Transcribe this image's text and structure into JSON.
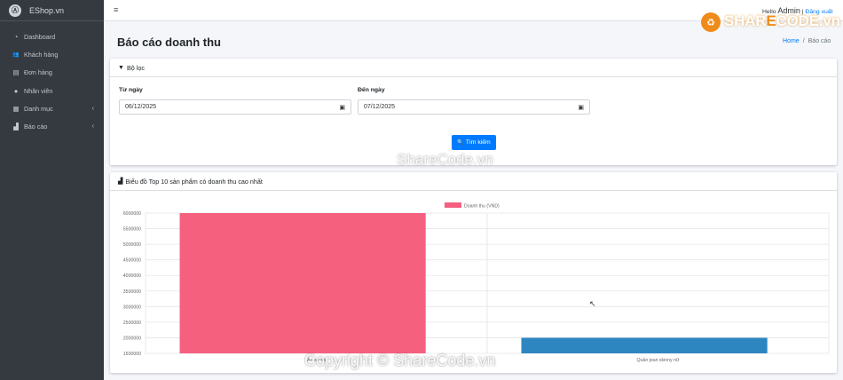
{
  "sidebar": {
    "brand": "EShop.vn",
    "brand_logo": "Ⓐ",
    "items": [
      {
        "label": "Dashboard",
        "icon": "dashboard-icon",
        "glyph": "◔"
      },
      {
        "label": "Khách hàng",
        "icon": "users-icon",
        "glyph": "👥"
      },
      {
        "label": "Đơn hàng",
        "icon": "file-icon",
        "glyph": "▤"
      },
      {
        "label": "Nhân viên",
        "icon": "user-icon",
        "glyph": "●"
      },
      {
        "label": "Danh mục",
        "icon": "table-icon",
        "glyph": "▦",
        "chevron": "‹"
      },
      {
        "label": "Báo cáo",
        "icon": "chart-icon",
        "glyph": "▟",
        "chevron": "‹"
      }
    ]
  },
  "topbar": {
    "menu_glyph": "≡",
    "hello": "Hello",
    "user": "Admin",
    "separator": "|",
    "logout": "Đăng xuất"
  },
  "logo": {
    "glyph": "♻",
    "pre": "SHAR",
    "o": "E",
    "post": "CODE.vn"
  },
  "page": {
    "title": "Báo cáo doanh thu",
    "breadcrumb": {
      "home": "Home",
      "sep": "/",
      "current": "Báo cáo"
    }
  },
  "filter": {
    "title": "Bộ lọc",
    "title_glyph": "▼",
    "from_label": "Từ ngày",
    "from_value": "06/12/2025",
    "to_label": "Đến ngày",
    "to_value": "07/12/2025",
    "cal_glyph": "▣",
    "search_glyph": "🔍",
    "search_label": "Tìm kiếm"
  },
  "chart_card": {
    "title": "Biểu đồ Top 10 sản phẩm có doanh thu cao nhất",
    "title_glyph": "▟"
  },
  "chart_data": {
    "type": "bar",
    "categories": [
      "Áo sơ mi",
      "Quần jean skinny nữ"
    ],
    "series": [
      {
        "name": "Doanh thu (VND)",
        "values": [
          6000000,
          2000000
        ],
        "colors": [
          "#f5607f",
          "#2e86c1"
        ]
      }
    ],
    "legend": "top-center",
    "legend_color": "#f5607f",
    "ylim": [
      1500000,
      6000000
    ],
    "yticks": [
      6000000,
      5500000,
      5000000,
      4500000,
      4000000,
      3500000,
      3000000,
      2500000,
      2000000,
      1500000
    ],
    "grid": true
  },
  "watermarks": {
    "center": "ShareCode.vn",
    "bottom": "Copyright © ShareCode.vn"
  },
  "cursor": "↖"
}
